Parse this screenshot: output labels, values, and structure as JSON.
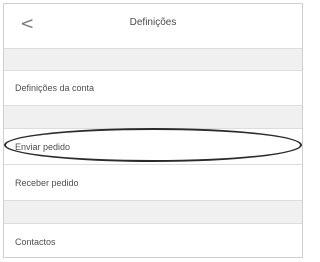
{
  "header": {
    "back_icon": "chevron-left-icon",
    "back_glyph": "<",
    "title": "Definições"
  },
  "menu": {
    "items": [
      {
        "label": "Definições da conta"
      },
      {
        "label": "Enviar pedido"
      },
      {
        "label": "Receber pedido"
      },
      {
        "label": "Contactos"
      }
    ]
  },
  "colors": {
    "background": "#f0f0f0",
    "row": "#ffffff",
    "highlight_stroke": "#2b2b2b"
  }
}
